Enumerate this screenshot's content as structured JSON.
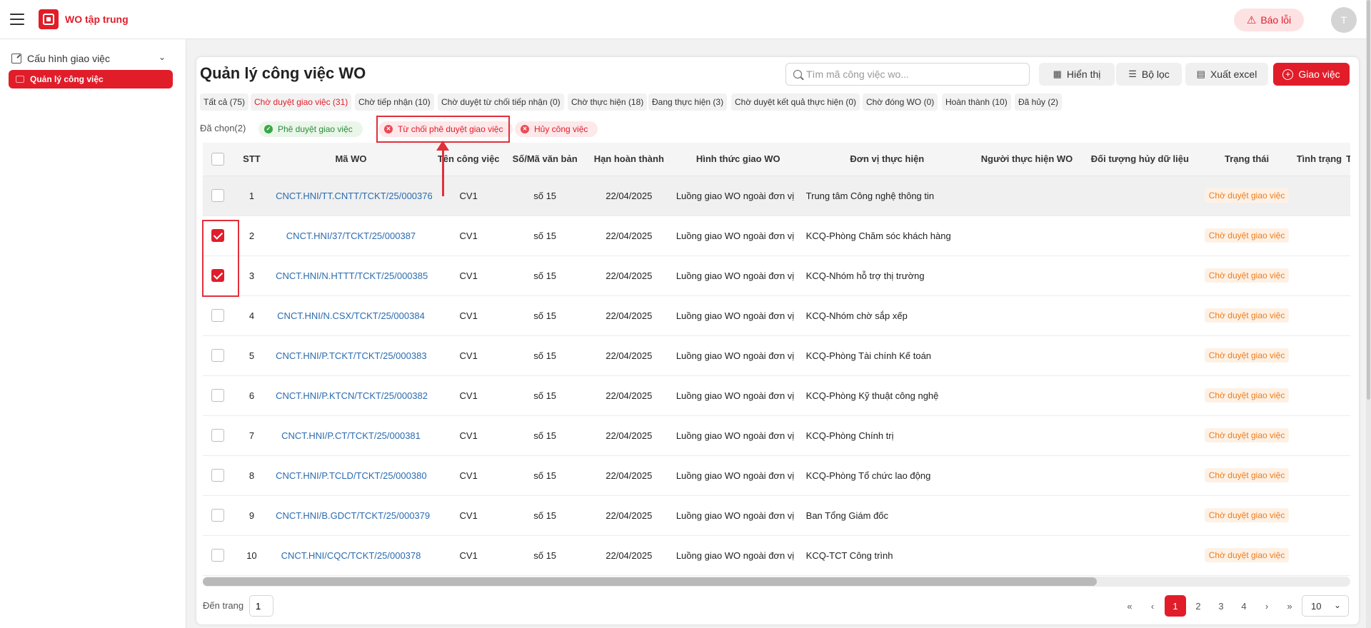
{
  "app": {
    "title": "WO tập trung"
  },
  "topbar": {
    "report_label": "Báo lỗi",
    "avatar_initial": "T"
  },
  "sidebar": {
    "group_label": "Cấu hình giao việc",
    "active_item": "Quản lý công việc"
  },
  "page": {
    "title": "Quản lý công việc WO"
  },
  "search": {
    "placeholder": "Tìm mã công việc wo..."
  },
  "toolbar": {
    "display_label": "Hiển thị",
    "filter_label": "Bộ lọc",
    "export_label": "Xuất excel",
    "assign_label": "Giao việc"
  },
  "status_tabs": [
    "Tất cả (75)",
    "Chờ duyệt giao việc (31)",
    "Chờ tiếp nhận (10)",
    "Chờ duyệt từ chối tiếp nhận (0)",
    "Chờ thực hiện (18)",
    "Đang thực hiện (3)",
    "Chờ duyệt kết quả thực hiện (0)",
    "Chờ đóng WO (0)",
    "Hoàn thành (10)",
    "Đã hủy (2)"
  ],
  "active_tab_index": 1,
  "selection": {
    "label": "Đã chọn(2)",
    "approve_label": "Phê duyệt giao việc",
    "reject_label": "Từ chối phê duyệt giao việc",
    "cancel_label": "Hủy công việc"
  },
  "table": {
    "columns": [
      "STT",
      "Mã WO",
      "Tên công việc",
      "Số/Mã văn bản",
      "Hạn hoàn thành",
      "Hình thức giao WO",
      "Đơn vị thực hiện",
      "Người thực hiện WO",
      "Đối tượng hủy dữ liệu",
      "Trạng thái",
      "Tình trạng",
      "Thao tác"
    ],
    "rows": [
      {
        "stt": "1",
        "code": "CNCT.HNI/TT.CNTT/TCKT/25/000376",
        "name": "CV1",
        "doc": "số 15",
        "due": "22/04/2025",
        "method": "Luồng giao WO ngoài đơn vị",
        "unit": "Trung tâm Công nghệ thông tin",
        "assignee": "",
        "cancel_obj": "",
        "status": "Chờ duyệt giao việc",
        "state": "",
        "checked": false
      },
      {
        "stt": "2",
        "code": "CNCT.HNI/37/TCKT/25/000387",
        "name": "CV1",
        "doc": "số 15",
        "due": "22/04/2025",
        "method": "Luồng giao WO ngoài đơn vị",
        "unit": "KCQ-Phòng Chăm sóc khách hàng",
        "assignee": "",
        "cancel_obj": "",
        "status": "Chờ duyệt giao việc",
        "state": "",
        "checked": true
      },
      {
        "stt": "3",
        "code": "CNCT.HNI/N.HTTT/TCKT/25/000385",
        "name": "CV1",
        "doc": "số 15",
        "due": "22/04/2025",
        "method": "Luồng giao WO ngoài đơn vị",
        "unit": "KCQ-Nhóm hỗ trợ thị trường",
        "assignee": "",
        "cancel_obj": "",
        "status": "Chờ duyệt giao việc",
        "state": "",
        "checked": true
      },
      {
        "stt": "4",
        "code": "CNCT.HNI/N.CSX/TCKT/25/000384",
        "name": "CV1",
        "doc": "số 15",
        "due": "22/04/2025",
        "method": "Luồng giao WO ngoài đơn vị",
        "unit": "KCQ-Nhóm chờ sắp xếp",
        "assignee": "",
        "cancel_obj": "",
        "status": "Chờ duyệt giao việc",
        "state": "",
        "checked": false
      },
      {
        "stt": "5",
        "code": "CNCT.HNI/P.TCKT/TCKT/25/000383",
        "name": "CV1",
        "doc": "số 15",
        "due": "22/04/2025",
        "method": "Luồng giao WO ngoài đơn vị",
        "unit": "KCQ-Phòng Tài chính Kế toán",
        "assignee": "",
        "cancel_obj": "",
        "status": "Chờ duyệt giao việc",
        "state": "",
        "checked": false
      },
      {
        "stt": "6",
        "code": "CNCT.HNI/P.KTCN/TCKT/25/000382",
        "name": "CV1",
        "doc": "số 15",
        "due": "22/04/2025",
        "method": "Luồng giao WO ngoài đơn vị",
        "unit": "KCQ-Phòng Kỹ thuật công nghệ",
        "assignee": "",
        "cancel_obj": "",
        "status": "Chờ duyệt giao việc",
        "state": "",
        "checked": false
      },
      {
        "stt": "7",
        "code": "CNCT.HNI/P.CT/TCKT/25/000381",
        "name": "CV1",
        "doc": "số 15",
        "due": "22/04/2025",
        "method": "Luồng giao WO ngoài đơn vị",
        "unit": "KCQ-Phòng Chính trị",
        "assignee": "",
        "cancel_obj": "",
        "status": "Chờ duyệt giao việc",
        "state": "",
        "checked": false
      },
      {
        "stt": "8",
        "code": "CNCT.HNI/P.TCLD/TCKT/25/000380",
        "name": "CV1",
        "doc": "số 15",
        "due": "22/04/2025",
        "method": "Luồng giao WO ngoài đơn vị",
        "unit": "KCQ-Phòng Tổ chức lao động",
        "assignee": "",
        "cancel_obj": "",
        "status": "Chờ duyệt giao việc",
        "state": "",
        "checked": false
      },
      {
        "stt": "9",
        "code": "CNCT.HNI/B.GDCT/TCKT/25/000379",
        "name": "CV1",
        "doc": "số 15",
        "due": "22/04/2025",
        "method": "Luồng giao WO ngoài đơn vị",
        "unit": "Ban Tổng Giám đốc",
        "assignee": "",
        "cancel_obj": "",
        "status": "Chờ duyệt giao việc",
        "state": "",
        "checked": false
      },
      {
        "stt": "10",
        "code": "CNCT.HNI/CQC/TCKT/25/000378",
        "name": "CV1",
        "doc": "số 15",
        "due": "22/04/2025",
        "method": "Luồng giao WO ngoài đơn vị",
        "unit": "KCQ-TCT Công trình",
        "assignee": "",
        "cancel_obj": "",
        "status": "Chờ duyệt giao việc",
        "state": "",
        "checked": false
      }
    ]
  },
  "footer": {
    "goto_label": "Đến trang",
    "goto_value": "1",
    "first_icon": "«",
    "prev_icon": "‹",
    "pages": [
      "1",
      "2",
      "3",
      "4"
    ],
    "current_page": "1",
    "next_icon": "›",
    "last_icon": "»",
    "page_size": "10"
  },
  "colors": {
    "brand": "#e11d2a",
    "link": "#2b6cb0",
    "status_pending": "#f07c1a",
    "approve": "#2e8b3a"
  }
}
